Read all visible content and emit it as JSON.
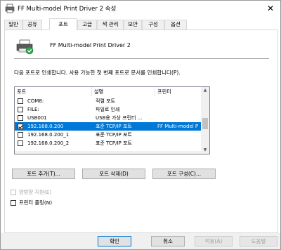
{
  "window": {
    "title": "FF Multi-model Print Driver 2 속성",
    "close_glyph": "✕"
  },
  "tabs": [
    {
      "label": "일반"
    },
    {
      "label": "공유"
    },
    {
      "label": "포트"
    },
    {
      "label": "고급"
    },
    {
      "label": "색 관리"
    },
    {
      "label": "보안"
    },
    {
      "label": "구성"
    },
    {
      "label": "옵션"
    }
  ],
  "active_tab": "포트",
  "printer": {
    "name": "FF Multi-model Print Driver 2",
    "icon": "printer-icon"
  },
  "description": "다음 포트로 인쇄합니다. 사용 가능한 첫 번째 포트로 문서를 인쇄합니다(P).",
  "ports_table": {
    "columns": [
      "포트",
      "설명",
      "프린터"
    ],
    "rows": [
      {
        "checked": false,
        "port": "COM8:",
        "description": "직렬 포트",
        "printer": "",
        "selected": false
      },
      {
        "checked": false,
        "port": "FILE:",
        "description": "파일로 인쇄",
        "printer": "",
        "selected": false
      },
      {
        "checked": false,
        "port": "USB001",
        "description": "USB용 가상 프린터 ...",
        "printer": "",
        "selected": false
      },
      {
        "checked": true,
        "port": "192.168.0.200",
        "description": "표준 TCP/IP 포트",
        "printer": "FF Multi-model P",
        "selected": true
      },
      {
        "checked": false,
        "port": "192.168.0.200_1",
        "description": "표준 TCP/IP 포트",
        "printer": "",
        "selected": false
      },
      {
        "checked": false,
        "port": "192.168.0.200_2",
        "description": "표준 TCP/IP 포트",
        "printer": "",
        "selected": false
      }
    ]
  },
  "port_buttons": {
    "add": "포트 추가(T)...",
    "delete": "포트 삭제(D)",
    "configure": "포트 구성(C)..."
  },
  "options": {
    "bidirectional": {
      "label": "양방향 지원(E)",
      "checked": false,
      "enabled": false
    },
    "pooling": {
      "label": "프린터 풀링(N)",
      "checked": false,
      "enabled": true
    }
  },
  "dialog_buttons": {
    "ok": "확인",
    "cancel": "취소",
    "apply": "적용(A)",
    "help": "도움말"
  },
  "colors": {
    "selection": "#0078d7",
    "window_bg": "#ffffff",
    "face": "#f0f0f0"
  }
}
